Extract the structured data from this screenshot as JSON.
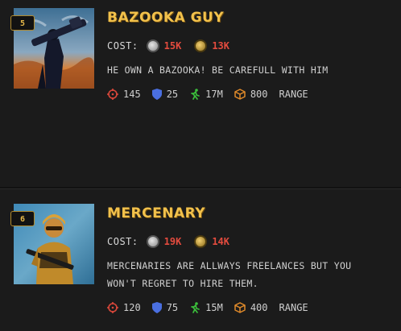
{
  "cards": [
    {
      "level": "5",
      "name": "Bazooka Guy",
      "cost_label": "COST:",
      "cost_silver": "15K",
      "cost_gold": "13K",
      "description": "HE OWN A BAZOOKA! BE CAREFULL WITH HIM",
      "stats": {
        "attack": "145",
        "defense": "25",
        "speed": "17M",
        "capacity": "800",
        "type": "RANGE"
      }
    },
    {
      "level": "6",
      "name": "Mercenary",
      "cost_label": "COST:",
      "cost_silver": "19K",
      "cost_gold": "14K",
      "description": "MERCENARIES ARE ALLWAYS FREELANCES BUT YOU WON'T REGRET TO HIRE THEM.",
      "stats": {
        "attack": "120",
        "defense": "75",
        "speed": "15M",
        "capacity": "400",
        "type": "RANGE"
      }
    }
  ],
  "colors": {
    "accent": "#f2c14b",
    "cost": "#e34b3e",
    "attack": "#d9473a",
    "defense": "#4a6fe0",
    "speed": "#3bbf3b",
    "capacity": "#e08a2a"
  }
}
